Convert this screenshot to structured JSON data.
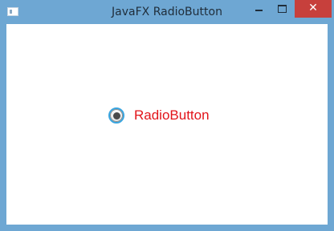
{
  "window": {
    "title": "JavaFX RadioButton",
    "close_glyph": "✕",
    "title_bar_color": "#6ea7d3",
    "close_button_color": "#c7403c"
  },
  "controls": {
    "radio": {
      "label": "RadioButton",
      "selected": true,
      "focused": true,
      "label_color": "#e2141a",
      "focus_color": "#39a5e0"
    }
  },
  "icons": [
    "app-icon",
    "minimize-icon",
    "maximize-icon",
    "close-icon"
  ]
}
